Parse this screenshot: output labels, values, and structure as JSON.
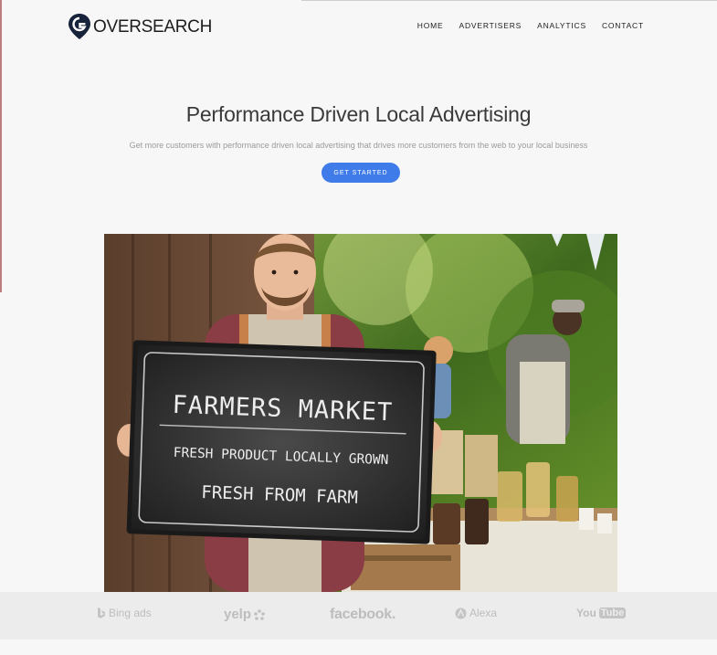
{
  "brand": {
    "name": "OVERSEARCH"
  },
  "nav": {
    "items": [
      "HOME",
      "ADVERTISERS",
      "ANALYTICS",
      "CONTACT"
    ]
  },
  "hero": {
    "title": "Performance Driven Local Advertising",
    "subtitle": "Get more customers with performance driven local advertising that drives more customers from the web to your local business",
    "cta_label": "GET STARTED"
  },
  "photo": {
    "sign_line1": "FARMERS MARKET",
    "sign_line2": "FRESH PRODUCT LOCALLY GROWN",
    "sign_line3": "FRESH FROM FARM"
  },
  "partners": {
    "bing": "Bing ads",
    "yelp": "yelp",
    "facebook": "facebook.",
    "alexa": "Alexa",
    "youtube_you": "You",
    "youtube_tube": "Tube"
  },
  "colors": {
    "accent": "#3f7be9",
    "logo_mark": "#16233a"
  }
}
